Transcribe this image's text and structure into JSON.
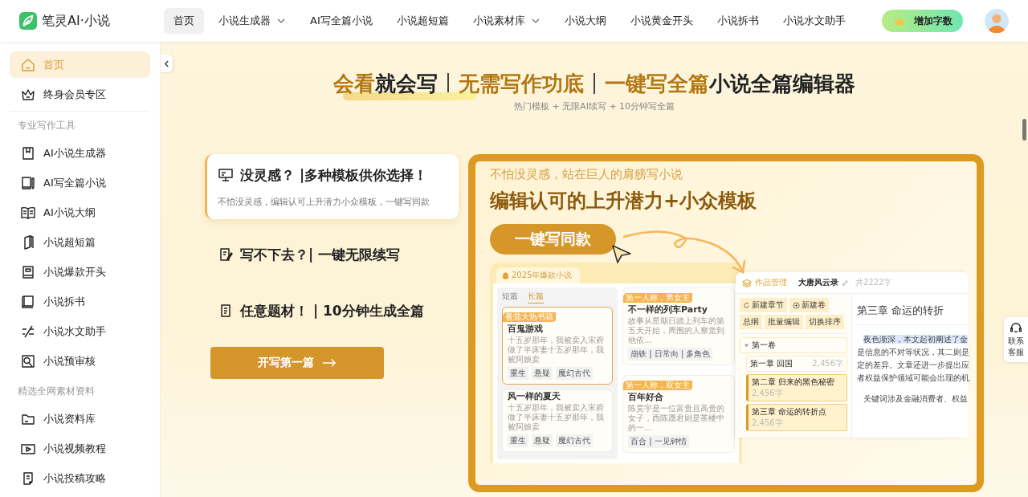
{
  "header": {
    "logo": "笔灵AI·小说",
    "nav": [
      {
        "label": "首页",
        "selected": true,
        "dropdown": false
      },
      {
        "label": "小说生成器",
        "selected": false,
        "dropdown": true
      },
      {
        "label": "AI写全篇小说",
        "selected": false,
        "dropdown": false
      },
      {
        "label": "小说超短篇",
        "selected": false,
        "dropdown": false
      },
      {
        "label": "小说素材库",
        "selected": false,
        "dropdown": true
      },
      {
        "label": "小说大纲",
        "selected": false,
        "dropdown": false
      },
      {
        "label": "小说黄金开头",
        "selected": false,
        "dropdown": false
      },
      {
        "label": "小说拆书",
        "selected": false,
        "dropdown": false
      },
      {
        "label": "小说水文助手",
        "selected": false,
        "dropdown": false
      }
    ],
    "action_button": "增加字数"
  },
  "sidebar": {
    "groups": [
      {
        "items": [
          {
            "label": "首页",
            "selected": true
          },
          {
            "label": "终身会员专区",
            "selected": false
          }
        ]
      },
      {
        "heading": "专业写作工具",
        "items": [
          {
            "label": "AI小说生成器",
            "selected": false
          },
          {
            "label": "AI写全篇小说",
            "selected": false
          },
          {
            "label": "AI小说大纲",
            "selected": false
          },
          {
            "label": "小说超短篇",
            "selected": false
          },
          {
            "label": "小说爆款开头",
            "selected": false
          },
          {
            "label": "小说拆书",
            "selected": false
          },
          {
            "label": "小说水文助手",
            "selected": false
          },
          {
            "label": "小说预审核",
            "selected": false
          }
        ]
      },
      {
        "heading": "精选全网素材资料",
        "items": [
          {
            "label": "小说资料库",
            "selected": false
          },
          {
            "label": "小说视频教程",
            "selected": false
          },
          {
            "label": "小说投稿攻略",
            "selected": false
          }
        ]
      }
    ]
  },
  "hero": {
    "title_groups": [
      {
        "parts": [
          {
            "text": "会看",
            "accent": true
          },
          {
            "text": "就会写",
            "accent": false
          }
        ]
      },
      {
        "parts": [
          {
            "text": "无需写作功底",
            "accent": true
          }
        ]
      },
      {
        "parts": [
          {
            "text": "一键写全篇",
            "accent": true
          },
          {
            "text": "小说全篇编辑器",
            "accent": false
          }
        ]
      }
    ],
    "subtitle": "热门模板 + 无限AI续写 + 10分钟写全篇"
  },
  "features": [
    {
      "title": "没灵感？ |多种模板供你选择！",
      "desc": "不怕没灵感，编辑认可上升潜力小众模板，一键写同款",
      "selected": true
    },
    {
      "title": "写不下去？| 一键无限续写",
      "selected": false
    },
    {
      "title": "任意题材！ | 10分钟生成全篇",
      "selected": false
    }
  ],
  "start_button": "开写第一篇",
  "promo": {
    "subtitle": "不怕没灵感，站在巨人的肩膀写小说",
    "title": "编辑认可的上升潜力+小众模板",
    "button": "一键写同款",
    "mockup": {
      "tab": "2025年爆款小说",
      "list_tabs": [
        {
          "label": "短篇",
          "selected": false
        },
        {
          "label": "长篇",
          "selected": true
        }
      ],
      "stories": [
        {
          "badge": "番茄大热书籍",
          "title": "百鬼游戏",
          "desc": "十五岁那年，我被卖入宋府做了半床妻十五岁那年，我被阿娘卖",
          "tags": [
            "重生",
            "悬疑",
            "魔幻古代"
          ],
          "selected": true
        },
        {
          "title": "风一样的夏天",
          "desc": "十五岁那年，我被卖入宋府做了半床妻十五岁那年，我被阿娘卖",
          "tags": [
            "重生",
            "悬疑",
            "魔幻古代"
          ],
          "selected": false
        }
      ],
      "featured": [
        {
          "badge": "第一人称，男女主",
          "title": "不一样的列车Party",
          "desc": "故事从星期日踏上列车的第五天开始，周围的人察觉到他依...",
          "tags": "崩铁 | 日常向 | 多角色"
        },
        {
          "badge": "第一人称，双女主",
          "title": "百年好合",
          "desc": "陈昊宇是一位富贵且高贵的女子，西陈愿君则是茶楼中的一...",
          "tags": "百合 | 一见钟情"
        }
      ],
      "editor": {
        "section": "作品管理",
        "book": "大唐风云录",
        "word_count": "共2222字",
        "buttons": [
          "新建章节",
          "新建卷",
          "总纲",
          "批量编辑",
          "切换排序"
        ],
        "volume": {
          "label": "第一卷",
          "expanded": true,
          "chapters": [
            {
              "title": "第一章 回国",
              "count": "2,456字",
              "selected": false
            },
            {
              "title": "第二章 归来的黑色秘密",
              "count": "2,456字",
              "selected": true
            },
            {
              "title": "第三章 命运的转折点",
              "count": "2,456字",
              "selected": true
            }
          ]
        },
        "chapter_heading": "第三章 命运的转折",
        "paragraphs": [
          {
            "lines": [
              {
                "text": "夜色渐深，本文起初阐述了金",
                "highlighted": true
              },
              {
                "text": "是信息的不对等状况，其二则是",
                "highlighted": false
              },
              {
                "text": "定的差异。文章还进一步提出应",
                "highlighted": false
              },
              {
                "text": "者权益保护领域可能会出现的机",
                "highlighted": false
              }
            ]
          },
          {
            "lines": [
              {
                "text": "关键词涉及金融消费者、权益",
                "highlighted": false
              }
            ]
          }
        ]
      }
    }
  },
  "support": "联系客服"
}
